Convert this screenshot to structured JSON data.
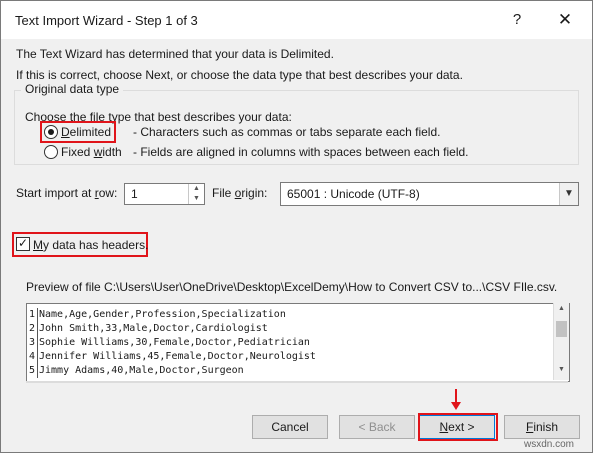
{
  "window": {
    "title": "Text Import Wizard - Step 1 of 3",
    "help_glyph": "?",
    "close_glyph": "✕"
  },
  "intro": {
    "line1": "The Text Wizard has determined that your data is Delimited.",
    "line2": "If this is correct, choose Next, or choose the data type that best describes your data."
  },
  "original_data_type": {
    "legend": "Original data type",
    "prompt": "Choose the file type that best describes your data:",
    "options": [
      {
        "label_accel": "D",
        "label_rest": "elimited",
        "description": "- Characters such as commas or tabs separate each field.",
        "selected": true
      },
      {
        "label_pre": "Fixed ",
        "label_accel": "w",
        "label_rest": "idth",
        "description": "- Fields are aligned in columns with spaces between each field.",
        "selected": false
      }
    ]
  },
  "start_import": {
    "label_pre": "Start import at ",
    "label_accel": "r",
    "label_rest": "ow:",
    "value": "1"
  },
  "file_origin": {
    "label_pre": "File ",
    "label_accel": "o",
    "label_rest": "rigin:",
    "value": "65001 : Unicode (UTF-8)"
  },
  "headers": {
    "label_accel": "M",
    "label_rest": "y data has headers.",
    "checked": true
  },
  "preview": {
    "caption": "Preview of file C:\\Users\\User\\OneDrive\\Desktop\\ExcelDemy\\How to Convert CSV to...\\CSV FIle.csv.",
    "rows": [
      {
        "num": "1",
        "text": "Name,Age,Gender,Profession,Specialization"
      },
      {
        "num": "2",
        "text": "John Smith,33,Male,Doctor,Cardiologist"
      },
      {
        "num": "3",
        "text": "Sophie Williams,30,Female,Doctor,Pediatrician"
      },
      {
        "num": "4",
        "text": "Jennifer Williams,45,Female,Doctor,Neurologist"
      },
      {
        "num": "5",
        "text": "Jimmy Adams,40,Male,Doctor,Surgeon"
      }
    ]
  },
  "buttons": {
    "cancel": "Cancel",
    "back": "< Back",
    "next_accel": "N",
    "next_rest": "ext >",
    "finish_accel": "F",
    "finish_rest": "inish"
  },
  "watermark": "wsxdn.com",
  "colors": {
    "highlight": "#e0141a",
    "accent": "#0078d7"
  }
}
